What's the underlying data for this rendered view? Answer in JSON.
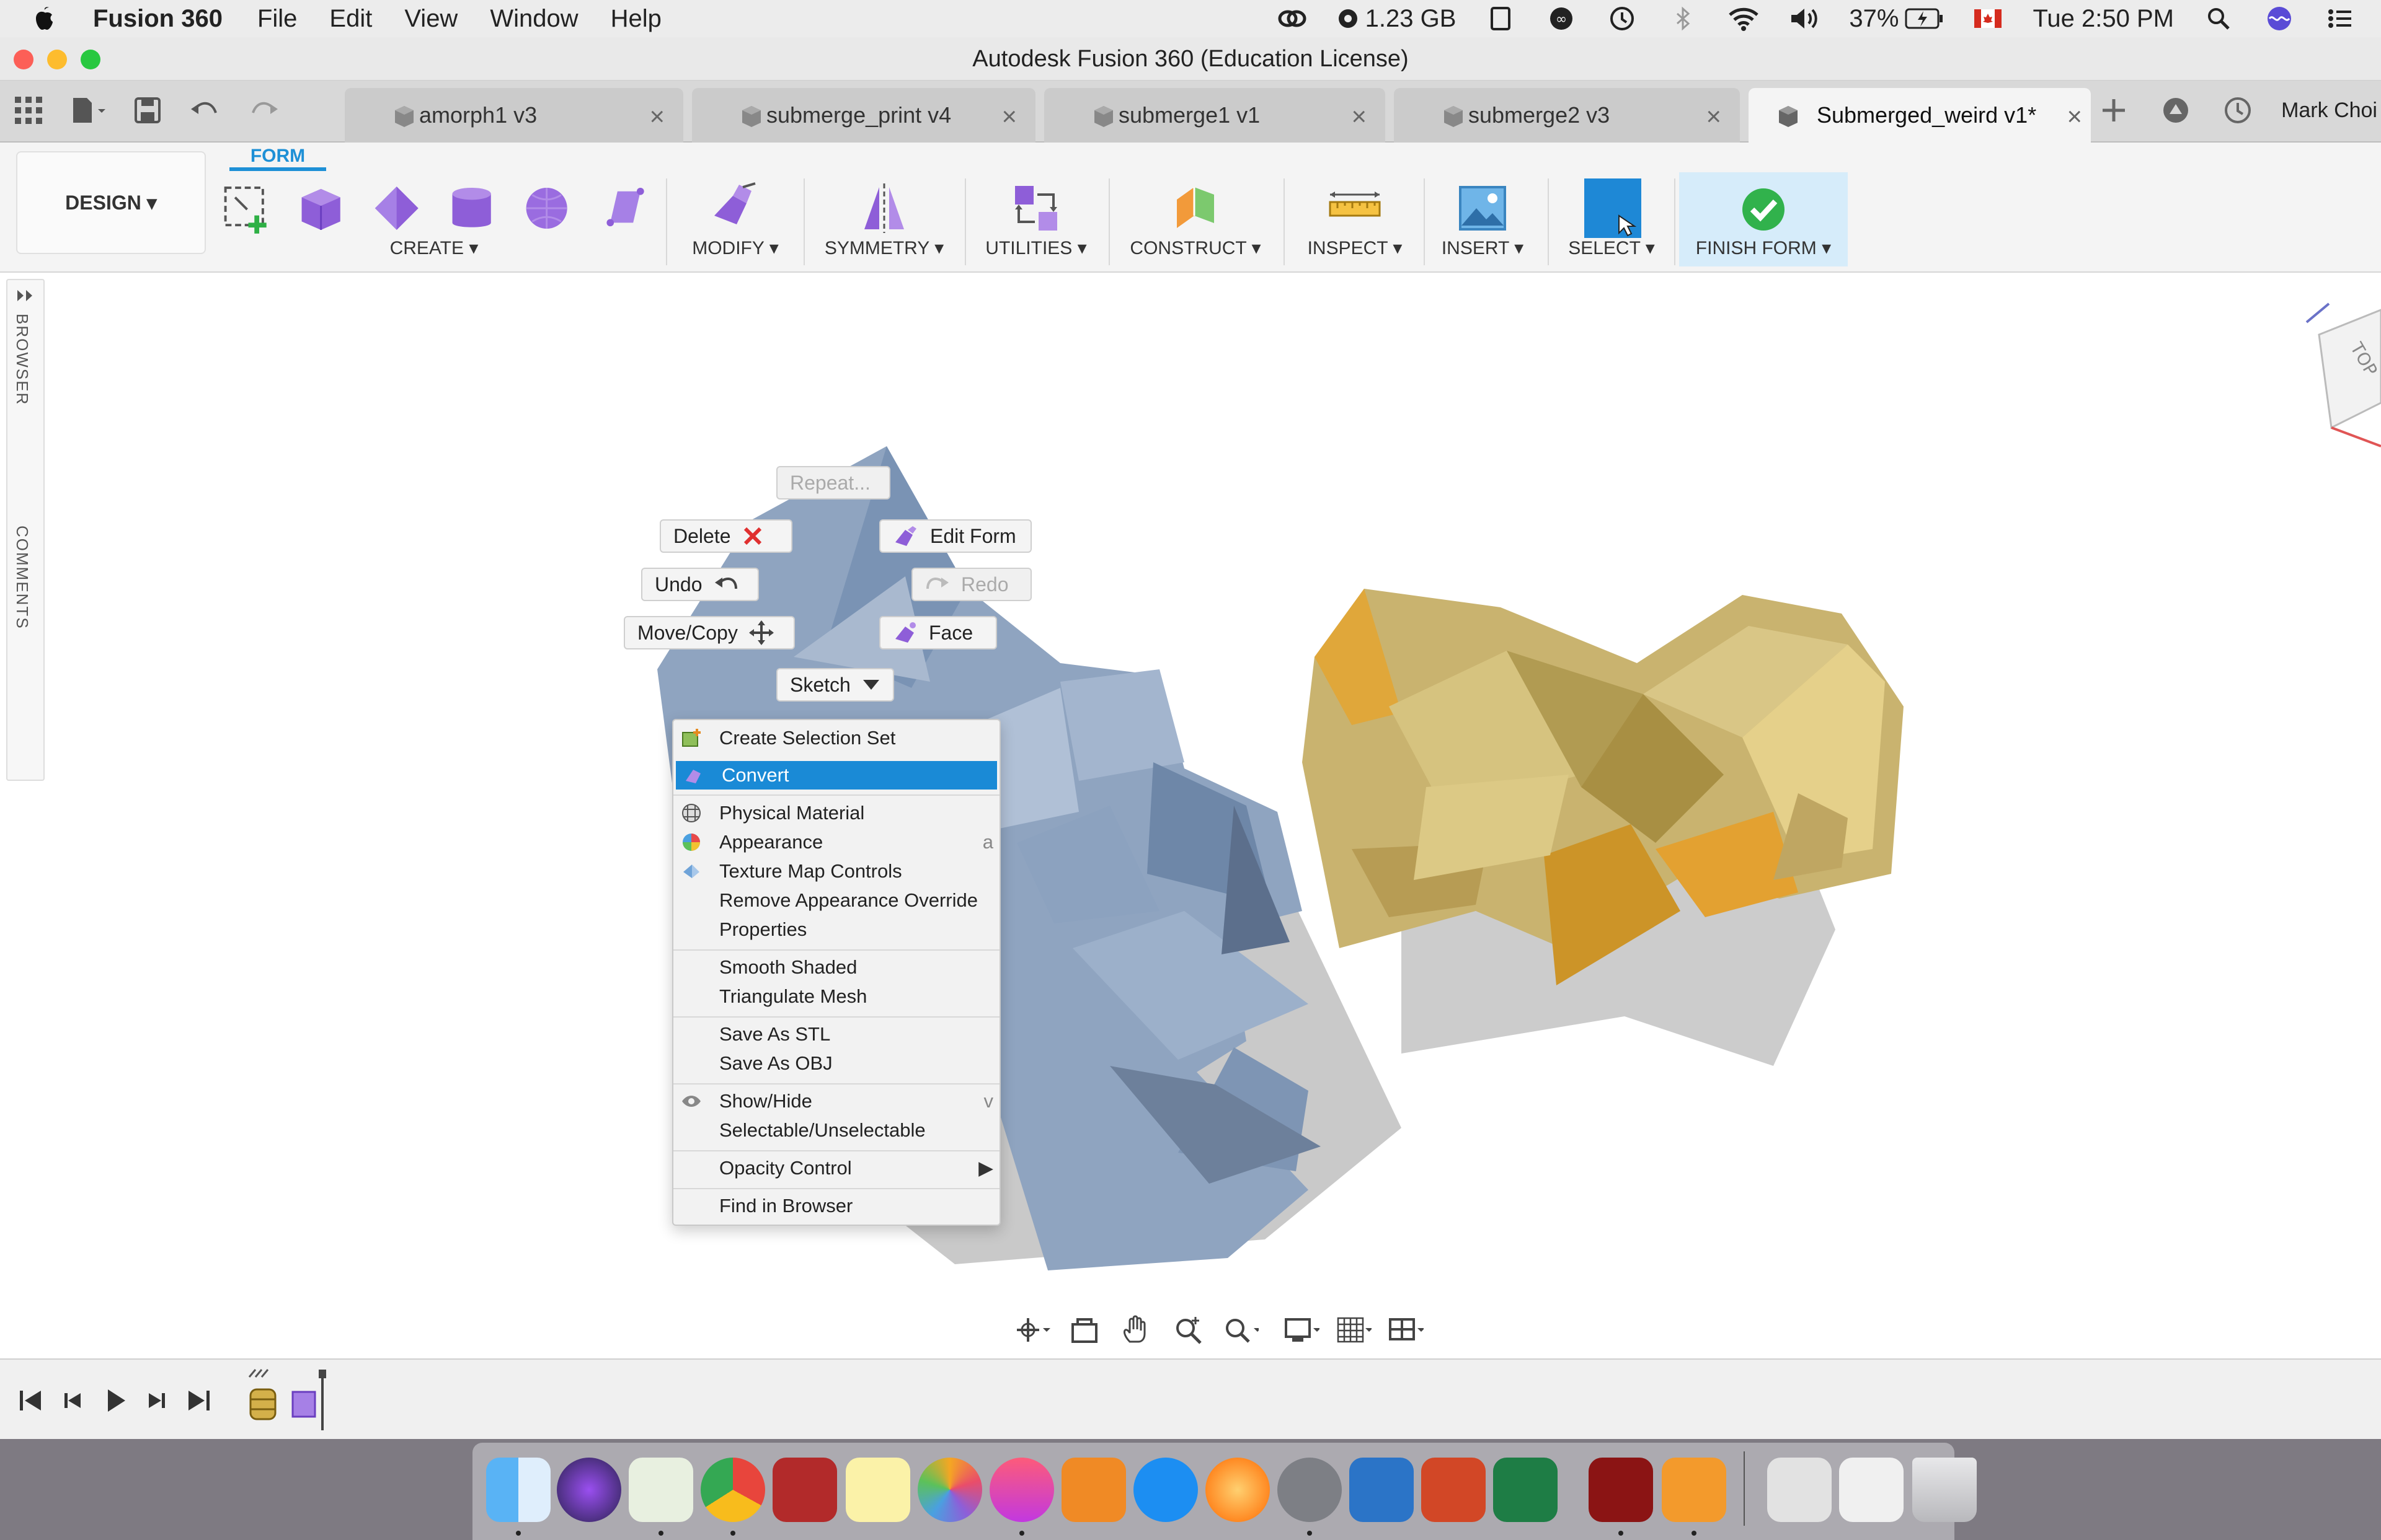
{
  "menubar": {
    "app_name": "Fusion 360",
    "items": [
      "File",
      "Edit",
      "View",
      "Window",
      "Help"
    ],
    "memory": "1.23 GB",
    "battery": "37%",
    "clock": "Tue 2:50 PM"
  },
  "window": {
    "title": "Autodesk Fusion 360 (Education License)"
  },
  "tabs": [
    {
      "label": "amorph1 v3"
    },
    {
      "label": "submerge_print v4"
    },
    {
      "label": "submerge1 v1"
    },
    {
      "label": "submerge2 v3"
    },
    {
      "label": "Submerged_weird v1*"
    }
  ],
  "user": {
    "name": "Mark Choi"
  },
  "toolbar": {
    "workspace": "DESIGN ▾",
    "active_tab": "FORM",
    "groups": [
      {
        "label": "CREATE ▾"
      },
      {
        "label": "MODIFY ▾"
      },
      {
        "label": "SYMMETRY ▾"
      },
      {
        "label": "UTILITIES ▾"
      },
      {
        "label": "CONSTRUCT ▾"
      },
      {
        "label": "INSPECT ▾"
      },
      {
        "label": "INSERT ▾"
      },
      {
        "label": "SELECT ▾"
      },
      {
        "label": "FINISH FORM ▾"
      }
    ]
  },
  "side_panel": {
    "browser": "BROWSER",
    "comments": "COMMENTS"
  },
  "marking_menu": {
    "repeat": "Repeat...",
    "delete": "Delete",
    "edit_form": "Edit Form",
    "undo": "Undo",
    "redo": "Redo",
    "move_copy": "Move/Copy",
    "face": "Face",
    "sketch": "Sketch"
  },
  "context_menu": {
    "items": [
      {
        "label": "Create Selection Set",
        "shortcut": ""
      },
      {
        "label": "Convert",
        "shortcut": "",
        "highlighted": true
      },
      {
        "label": "Physical Material",
        "shortcut": ""
      },
      {
        "label": "Appearance",
        "shortcut": "a"
      },
      {
        "label": "Texture Map Controls",
        "shortcut": ""
      },
      {
        "label": "Remove Appearance Override",
        "shortcut": ""
      },
      {
        "label": "Properties",
        "shortcut": ""
      },
      {
        "label": "Smooth Shaded",
        "shortcut": ""
      },
      {
        "label": "Triangulate Mesh",
        "shortcut": ""
      },
      {
        "label": "Save As STL",
        "shortcut": ""
      },
      {
        "label": "Save As OBJ",
        "shortcut": ""
      },
      {
        "label": "Show/Hide",
        "shortcut": "v"
      },
      {
        "label": "Selectable/Unselectable",
        "shortcut": ""
      },
      {
        "label": "Opacity Control",
        "shortcut": "▶"
      },
      {
        "label": "Find in Browser",
        "shortcut": ""
      }
    ]
  },
  "viewcube": {
    "face": "TOP"
  },
  "colors": {
    "accent": "#1a8ad6",
    "blue_mesh": "#8fa4bf",
    "gold_mesh": "#c9b36f"
  }
}
